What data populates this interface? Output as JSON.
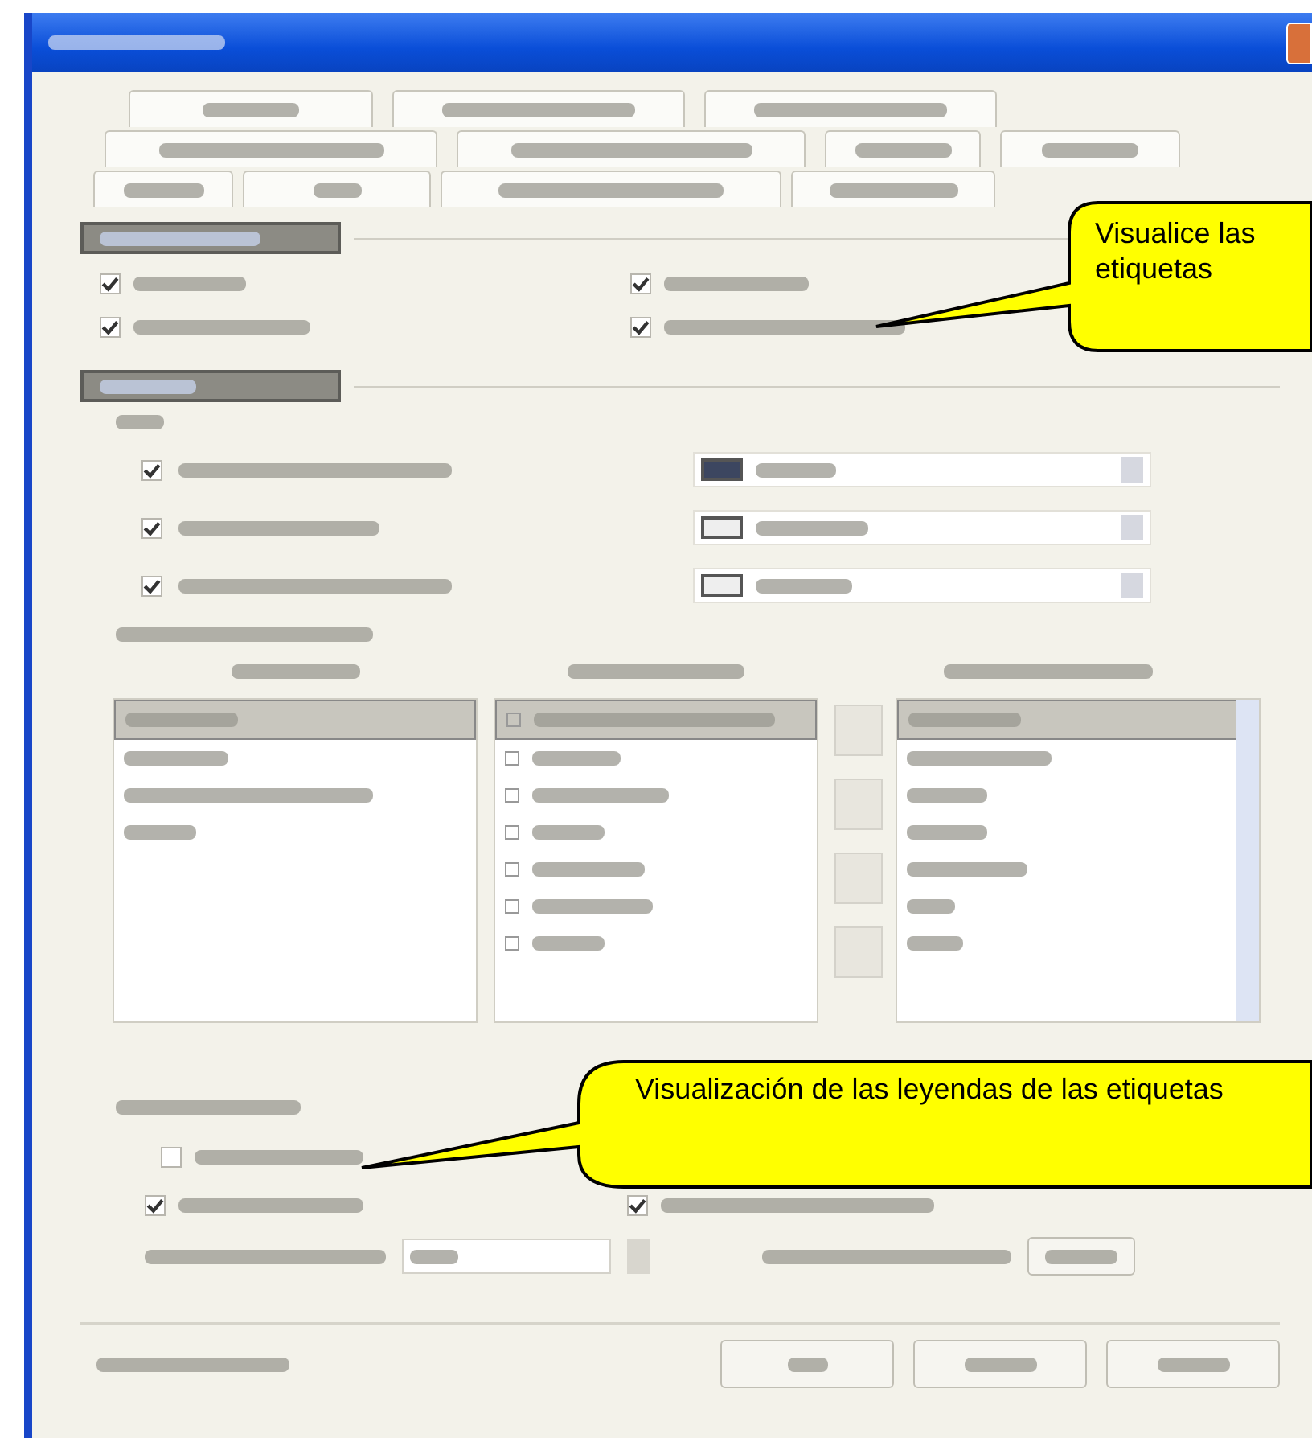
{
  "options_checkboxes": [
    {
      "checked": true
    },
    {
      "checked": true
    },
    {
      "checked": true
    },
    {
      "checked": true
    }
  ],
  "view_checkboxes": [
    {
      "checked": true
    },
    {
      "checked": true
    },
    {
      "checked": true
    }
  ],
  "field_lists": [
    {
      "items": [
        {
          "selected": true
        },
        {
          "selected": false
        },
        {
          "selected": false
        },
        {
          "selected": false
        }
      ]
    },
    {
      "items": [
        {
          "selected": true
        },
        {
          "selected": false
        },
        {
          "selected": false
        },
        {
          "selected": false
        },
        {
          "selected": false
        },
        {
          "selected": false
        },
        {
          "selected": false
        }
      ]
    },
    {
      "items": [
        {
          "selected": true
        },
        {
          "selected": false
        },
        {
          "selected": false
        },
        {
          "selected": false
        },
        {
          "selected": false
        },
        {
          "selected": false
        },
        {
          "selected": false
        }
      ]
    }
  ],
  "legend_checkboxes": [
    {
      "checked": false
    },
    {
      "checked": true
    },
    {
      "checked": true
    }
  ],
  "callouts": [
    {
      "text": "Visualice las etiquetas"
    },
    {
      "text": "Visualización de las leyendas de las etiquetas"
    }
  ]
}
